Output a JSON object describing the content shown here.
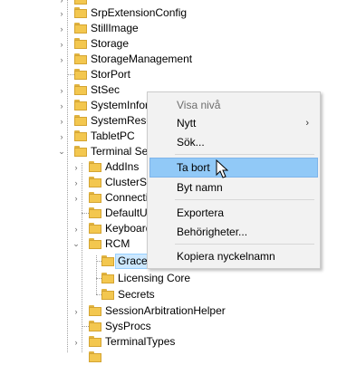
{
  "tree": {
    "items": [
      {
        "label": "SrpExtensionConfig"
      },
      {
        "label": "StillImage"
      },
      {
        "label": "Storage"
      },
      {
        "label": "StorageManagement"
      },
      {
        "label": "StorPort"
      },
      {
        "label": "StSec"
      },
      {
        "label": "SystemInfor"
      },
      {
        "label": "SystemResou"
      },
      {
        "label": "TabletPC"
      },
      {
        "label": "Terminal Ser"
      },
      {
        "label": "AddIns"
      },
      {
        "label": "ClusterSe"
      },
      {
        "label": "Connectio"
      },
      {
        "label": "DefaultUs"
      },
      {
        "label": "Keyboard"
      },
      {
        "label": "RCM"
      },
      {
        "label": "GraceP"
      },
      {
        "label": "Licensing Core"
      },
      {
        "label": "Secrets"
      },
      {
        "label": "SessionArbitrationHelper"
      },
      {
        "label": "SysProcs"
      },
      {
        "label": "TerminalTypes"
      }
    ]
  },
  "context_menu": {
    "items": [
      {
        "label": "Visa nivå",
        "state": "disabled"
      },
      {
        "label": "Nytt",
        "submenu_glyph": "›"
      },
      {
        "label": "Sök..."
      },
      {
        "label": "Ta bort",
        "state": "hover"
      },
      {
        "label": "Byt namn"
      },
      {
        "label": "Exportera"
      },
      {
        "label": "Behörigheter..."
      },
      {
        "label": "Kopiera nyckelnamn"
      }
    ]
  },
  "icons": {
    "folder": "folder-icon",
    "expand": "chevron-right-icon",
    "collapse": "chevron-down-icon",
    "cursor": "mouse-pointer-icon"
  },
  "colors": {
    "menu_bg": "#f2f2f2",
    "menu_hover": "#91c9f7",
    "selection": "#cce8ff",
    "folder": "#f3c74f"
  }
}
